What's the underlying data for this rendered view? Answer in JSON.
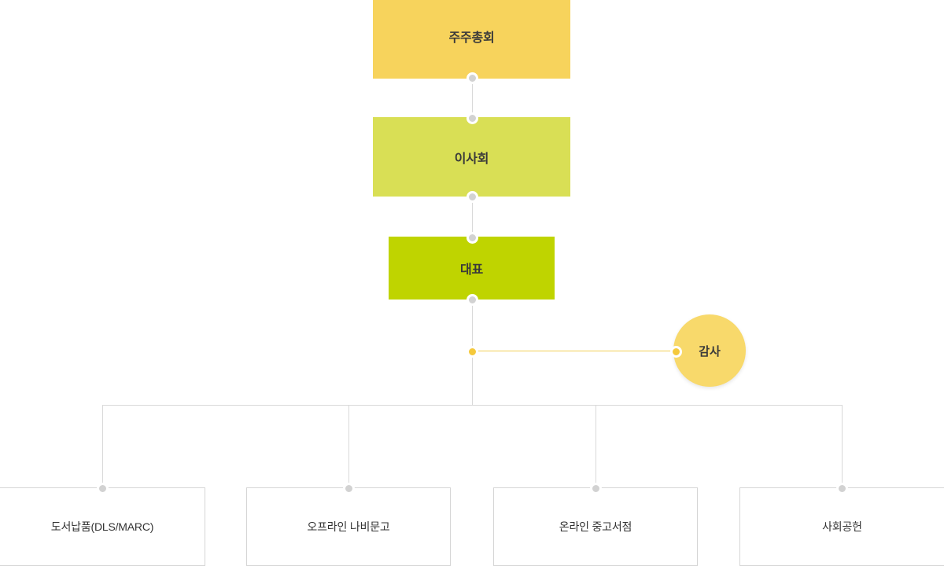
{
  "chart": {
    "type": "org-chart",
    "background_color": "#ffffff",
    "nodes": [
      {
        "id": "shareholders",
        "label": "주주총회",
        "shape": "rect",
        "color": "#f7d35c",
        "level": 1
      },
      {
        "id": "board",
        "label": "이사회",
        "shape": "rect",
        "color": "#d9df55",
        "level": 2
      },
      {
        "id": "ceo",
        "label": "대표",
        "shape": "rect",
        "color": "#bfd400",
        "level": 3
      },
      {
        "id": "auditor",
        "label": "감사",
        "shape": "circle",
        "color": "#f8d96b",
        "level": 3
      }
    ],
    "leaves": [
      {
        "id": "leaf-0",
        "label": "도서납품(DLS/MARC)"
      },
      {
        "id": "leaf-1",
        "label": "오프라인 나비문고"
      },
      {
        "id": "leaf-2",
        "label": "온라인 중고서점"
      },
      {
        "id": "leaf-3",
        "label": "사회공헌"
      }
    ],
    "connector_colors": {
      "line_gray": "#d8d8d8",
      "dot_gray": "#d2d2d2",
      "line_yellow": "#f2cf55",
      "dot_yellow": "#f5c93c"
    }
  }
}
